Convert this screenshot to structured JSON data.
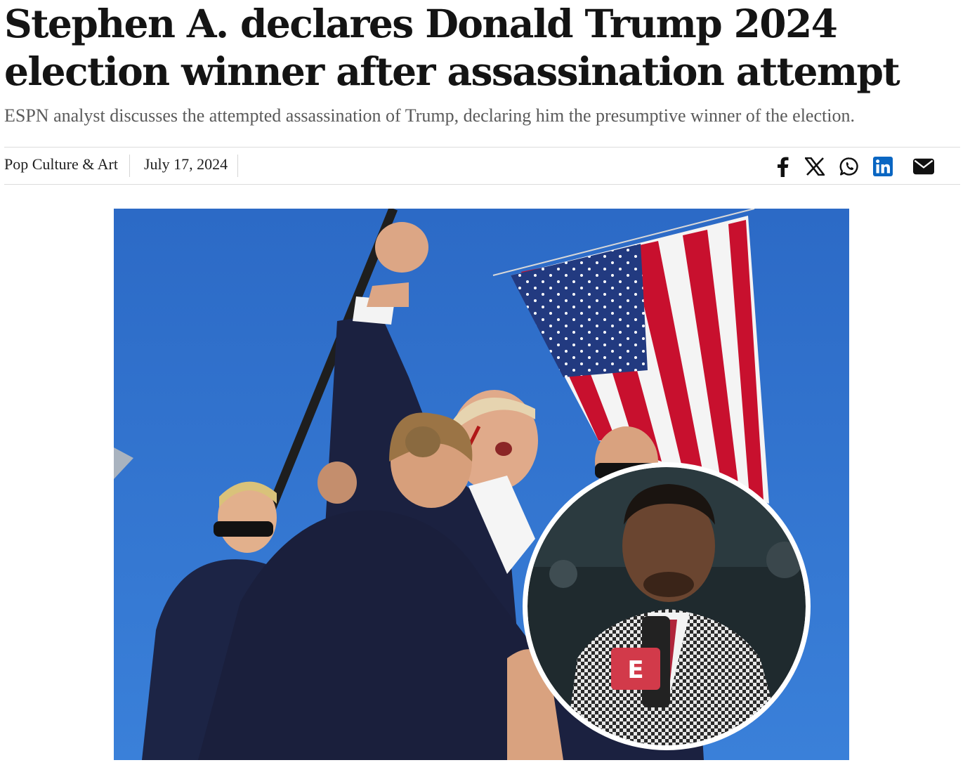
{
  "article": {
    "headline": "Stephen A. declares Donald Trump 2024 election winner after assassination attempt",
    "subheadline": "ESPN analyst discusses the attempted assassination of Trump, declaring him the presumptive winner of the election.",
    "category": "Pop Culture & Art",
    "date": "July 17, 2024"
  },
  "share": {
    "icons": [
      "facebook-icon",
      "x-icon",
      "whatsapp-icon",
      "linkedin-icon",
      "email-icon"
    ],
    "linkedin_color": "#0a66c2"
  },
  "hero": {
    "inset_badge_text": "E"
  },
  "colors": {
    "sky": "#2f6fc9",
    "flag_red": "#c8102e",
    "flag_blue": "#223a80",
    "suit_navy": "#1b2140"
  }
}
